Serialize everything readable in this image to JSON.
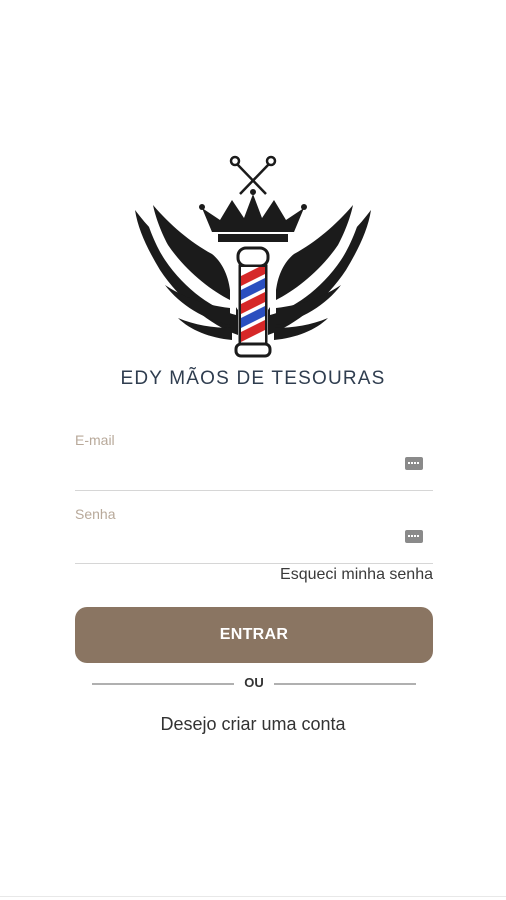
{
  "logo": {
    "brand_text": "EDY MÃOS DE TESOURAS",
    "icon": "barber-pole-crown-wings-logo"
  },
  "form": {
    "email": {
      "label": "E-mail",
      "value": "",
      "icon": "key-icon"
    },
    "password": {
      "label": "Senha",
      "value": "",
      "icon": "key-icon"
    },
    "forgot_password": "Esqueci minha senha",
    "submit_label": "ENTRAR",
    "divider_text": "OU",
    "create_account": "Desejo criar uma conta"
  },
  "colors": {
    "primary": "#8a7562",
    "label": "#b8a99a",
    "brand_text": "#2f3d4f"
  }
}
